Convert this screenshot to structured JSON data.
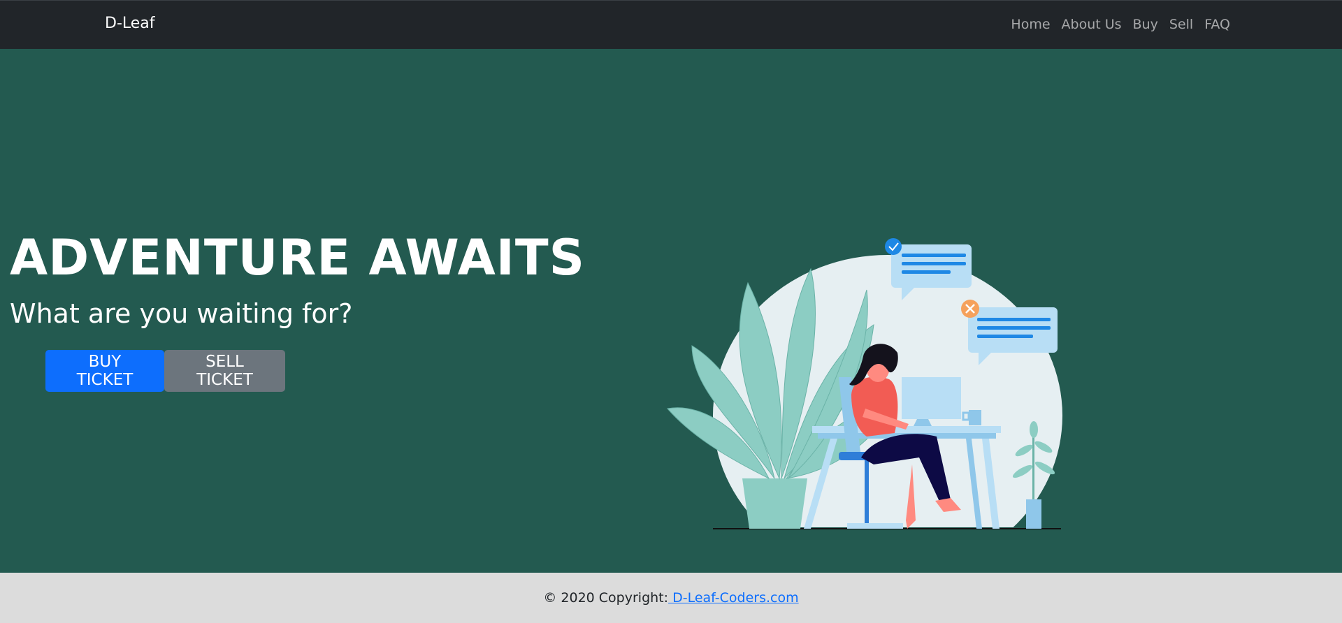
{
  "navbar": {
    "brand": "D-Leaf",
    "links": [
      "Home",
      "About Us",
      "Buy",
      "Sell",
      "FAQ"
    ]
  },
  "hero": {
    "title": "ADVENTURE AWAITS",
    "subtitle": "What are you waiting for?",
    "buy_button": "BUY TICKET",
    "sell_button": "SELL TICKET",
    "illustration": "person-working-at-desk-illustration"
  },
  "footer": {
    "copyright_text": "© 2020 Copyright:",
    "link_text": " D-Leaf-Coders.com"
  },
  "colors": {
    "navbar_bg": "#212529",
    "hero_bg": "#235a50",
    "buy_button": "#0d6efd",
    "sell_button": "#6c757d",
    "footer_bg": "#dcdcdc"
  }
}
